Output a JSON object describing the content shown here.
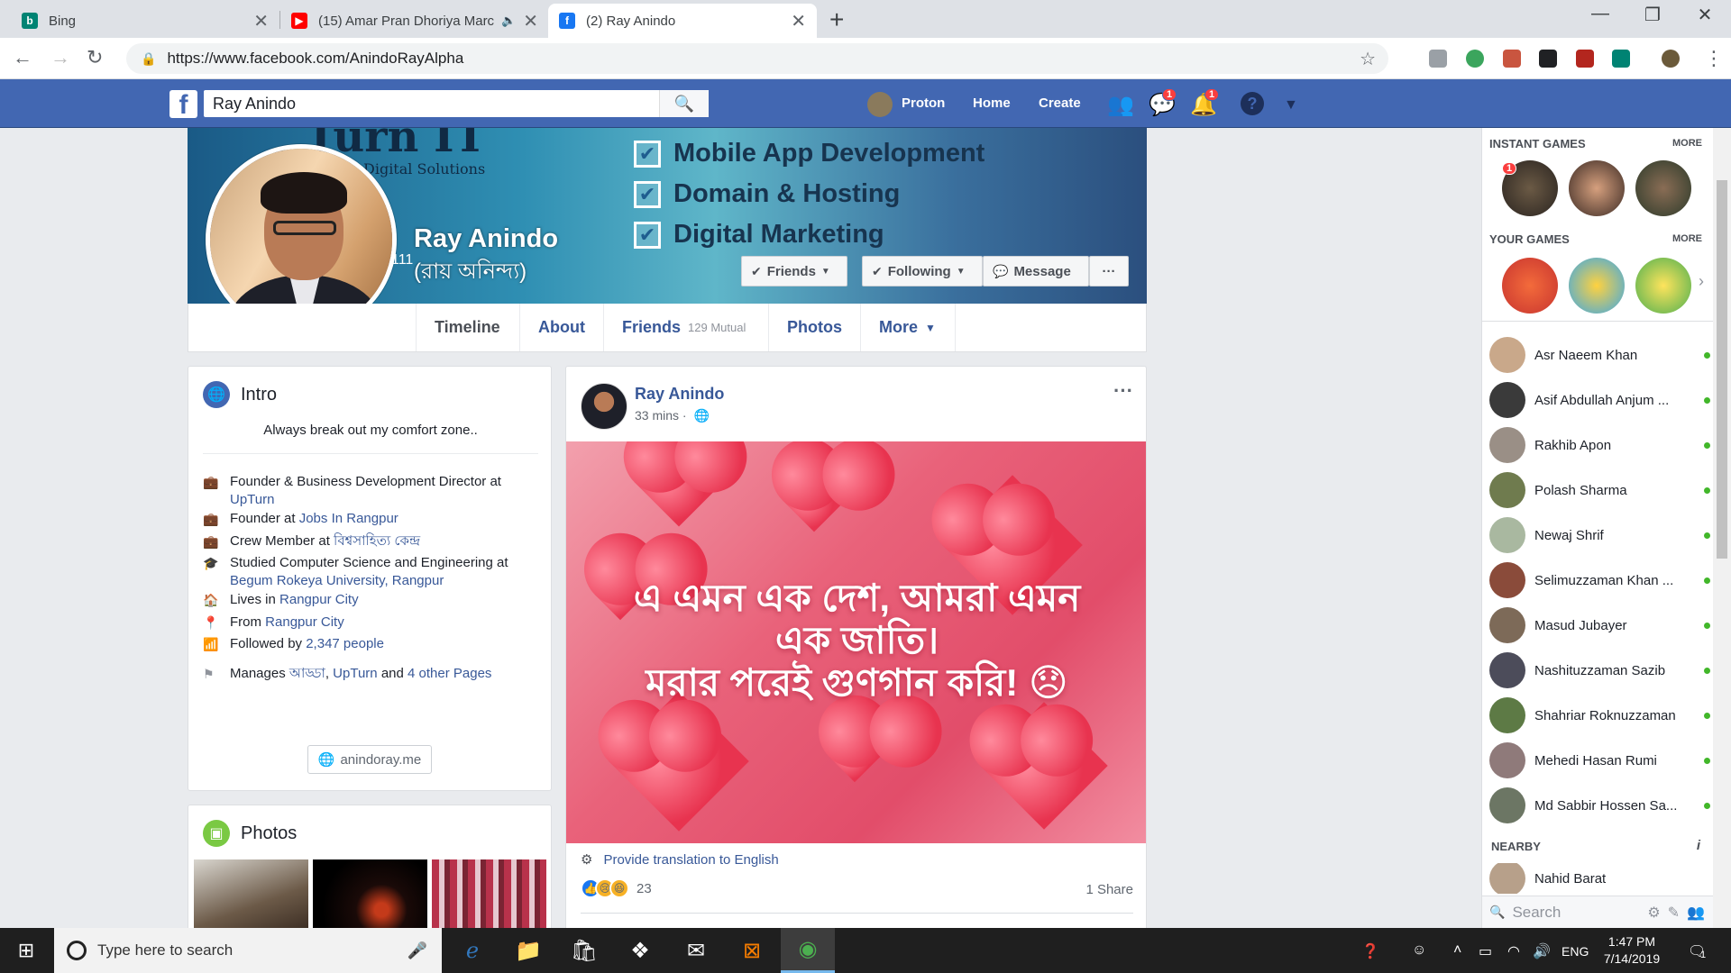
{
  "browser": {
    "tabs": [
      {
        "title": "Bing",
        "icon": "bing-icon",
        "color": "#008373"
      },
      {
        "title": "(15) Amar Pran Dhoriya Marc",
        "icon": "youtube-icon",
        "color": "#ff0000"
      },
      {
        "title": "(2) Ray Anindo",
        "icon": "facebook-icon",
        "color": "#1877f2"
      }
    ],
    "url": "https://www.facebook.com/AnindoRayAlpha"
  },
  "fb": {
    "search_value": "Ray Anindo",
    "nav": {
      "profile": "Proton",
      "home": "Home",
      "create": "Create"
    },
    "badges": {
      "messages": "1",
      "notifications": "1"
    }
  },
  "cover": {
    "brand_top": "Turn IT",
    "brand_sub": "Digital Solutions",
    "services": [
      "Mobile App Development",
      "Domain & Hosting",
      "Digital Marketing"
    ],
    "name": "Ray Anindo",
    "alt_name": "(রায় অনিন্দ্য)",
    "stray": "111",
    "buttons": {
      "friends": "Friends",
      "following": "Following",
      "message": "Message",
      "more": "···"
    }
  },
  "profile_tabs": {
    "timeline": "Timeline",
    "about": "About",
    "friends": "Friends",
    "friends_mutual": "129 Mutual",
    "photos": "Photos",
    "more": "More"
  },
  "intro": {
    "title": "Intro",
    "bio": "Always break out my comfort zone..",
    "rows": {
      "work1_prefix": "Founder & Business Development Director at",
      "work1_link": "UpTurn",
      "work2_prefix": "Founder at",
      "work2_link": "Jobs In Rangpur",
      "work3_prefix": "Crew Member at",
      "work3_link": "বিশ্বসাহিত্য কেন্দ্র",
      "edu_prefix": "Studied Computer Science and Engineering at",
      "edu_link": "Begum Rokeya University, Rangpur",
      "lives_prefix": "Lives in",
      "lives_link": "Rangpur City",
      "from_prefix": "From",
      "from_link": "Rangpur City",
      "followed_prefix": "Followed by",
      "followed_link": "2,347 people",
      "manages_prefix": "Manages",
      "manages_link1": "আড্ডা",
      "manages_sep": ",",
      "manages_link2": "UpTurn",
      "manages_and": "and",
      "manages_link3": "4 other Pages"
    },
    "website": "anindoray.me"
  },
  "photos_card": {
    "title": "Photos"
  },
  "post": {
    "author": "Ray Anindo",
    "time": "33 mins ·",
    "menu": "···",
    "text_line1": "এ এমন এক দেশ, আমরা এমন",
    "text_line2": "এক জাতি।",
    "text_line3": "মরার পরেই গুণগান করি! 😞",
    "translate": "Provide translation to English",
    "reaction_count": "23",
    "shares": "1 Share"
  },
  "sidebar": {
    "instant_games": "INSTANT GAMES",
    "your_games": "YOUR GAMES",
    "more": "MORE",
    "game_badge": "1",
    "contacts": [
      {
        "name": "Asr Naeem Khan"
      },
      {
        "name": "Asif Abdullah Anjum ..."
      },
      {
        "name": "Rakhib Apon"
      },
      {
        "name": "Polash Sharma"
      },
      {
        "name": "Newaj Shrif"
      },
      {
        "name": "Selimuzzaman Khan ..."
      },
      {
        "name": "Masud Jubayer"
      },
      {
        "name": "Nashituzzaman Sazib"
      },
      {
        "name": "Shahriar Roknuzzaman"
      },
      {
        "name": "Mehedi Hasan Rumi"
      },
      {
        "name": "Md Sabbir Hossen Sa..."
      }
    ],
    "nearby": "NEARBY",
    "nearby_contact": "Nahid Barat",
    "search_placeholder": "Search"
  },
  "taskbar": {
    "search_placeholder": "Type here to search",
    "lang": "ENG",
    "time": "1:47 PM",
    "date": "7/14/2019",
    "notif_count": "1"
  }
}
